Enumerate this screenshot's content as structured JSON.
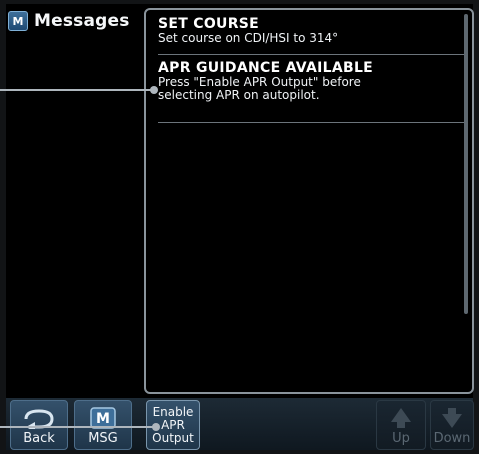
{
  "header": {
    "title": "Messages",
    "icon": "messages-m-icon"
  },
  "messages": [
    {
      "title": "SET COURSE",
      "body": [
        "Set course on CDI/HSI to 314°"
      ]
    },
    {
      "title": "APR GUIDANCE AVAILABLE",
      "body": [
        "Press \"Enable APR Output\" before",
        "selecting APR on autopilot."
      ]
    }
  ],
  "softkeys": {
    "back": {
      "label": "Back",
      "icon": "back-arrow-icon"
    },
    "msg": {
      "label": "MSG",
      "icon": "msg-icon"
    },
    "apr": {
      "lines": [
        "Enable",
        "APR",
        "Output"
      ]
    },
    "up": {
      "label": "Up",
      "icon": "up-arrow-icon",
      "enabled": false
    },
    "down": {
      "label": "Down",
      "icon": "down-arrow-icon",
      "enabled": false
    }
  },
  "colors": {
    "background": "#000000",
    "softkey": "#2a4560",
    "border": "#8a949c",
    "text": "#ffffff"
  }
}
